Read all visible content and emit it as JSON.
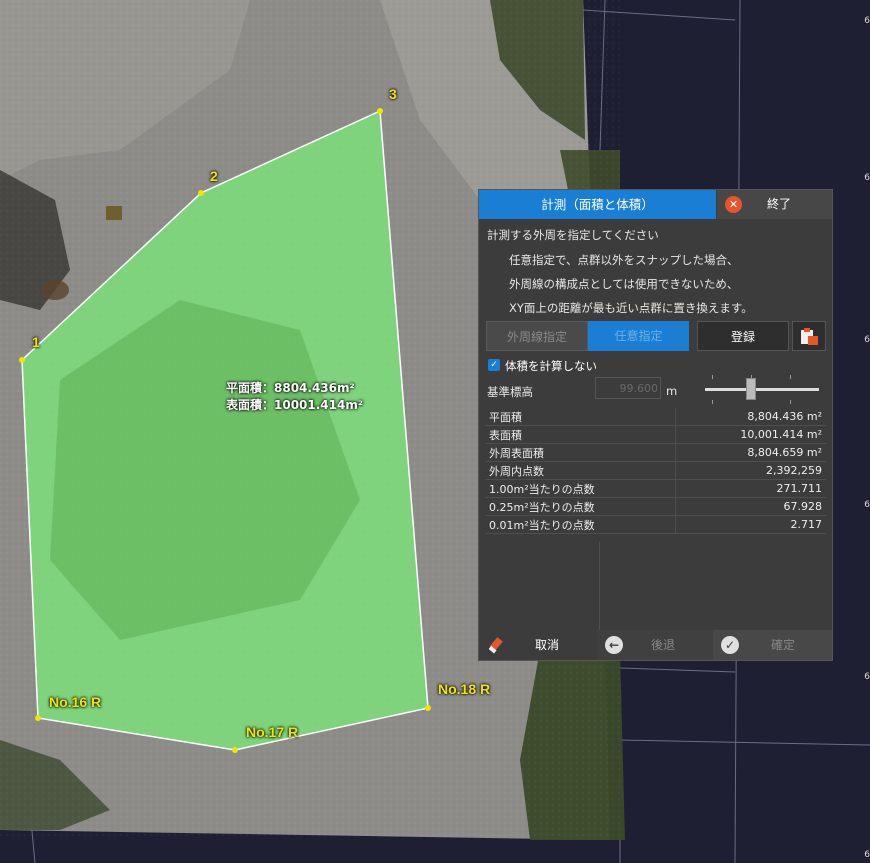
{
  "map": {
    "vertex_labels": [
      "1",
      "2",
      "3",
      "No.16 R",
      "No.17 R",
      "No.18 R"
    ],
    "area_labels": {
      "plane": "平面積：8804.436m²",
      "surface": "表面積：10001.414m²"
    },
    "edge_coords": [
      "6",
      "6",
      "6",
      "6",
      "6",
      "6"
    ],
    "fill_color": "#7be37a",
    "line_color": "#ffffff",
    "label_color": "#f2e600"
  },
  "panel": {
    "title": "計測（面積と体積）",
    "end_label": "終了",
    "close_icon": "close-icon",
    "instructions": [
      "計測する外周を指定してください",
      "任意指定で、点群以外をスナップした場合、",
      "外周線の構成点としては使用できないため、",
      "XY面上の距離が最も近い点群に置き換えます。"
    ],
    "mode_buttons": {
      "perimeter": "外周線指定",
      "arbitrary": "任意指定",
      "register": "登録"
    },
    "no_volume_label": "体積を計算しない",
    "base_height_label": "基準標高",
    "base_height_value": "99.600",
    "unit": "m",
    "accent": "#1a7fd4",
    "results": [
      {
        "label": "平面積",
        "value": "8,804.436 m²"
      },
      {
        "label": "表面積",
        "value": "10,001.414 m²"
      },
      {
        "label": "外周表面積",
        "value": "8,804.659 m²"
      },
      {
        "label": "外周内点数",
        "value": "2,392,259"
      },
      {
        "label": "1.00m²当たりの点数",
        "value": "271.711"
      },
      {
        "label": "0.25m²当たりの点数",
        "value": "67.928"
      },
      {
        "label": "0.01m²当たりの点数",
        "value": "2.717"
      }
    ],
    "footer": {
      "cancel": "取消",
      "back": "後退",
      "confirm": "確定"
    }
  }
}
